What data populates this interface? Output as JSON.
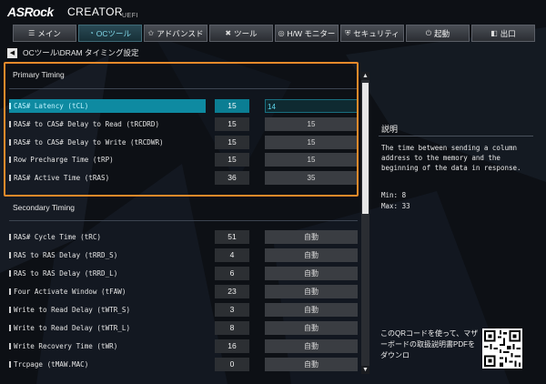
{
  "header": {
    "brand": "ASRock",
    "product": "CREATOR",
    "uefi": "UEFI"
  },
  "nav": [
    {
      "label": "メイン",
      "icon": "list-icon",
      "glyph": "☰"
    },
    {
      "label": "OCツール",
      "icon": "gauge-icon",
      "glyph": "◔",
      "active": true
    },
    {
      "label": "アドバンスド",
      "icon": "star-icon",
      "glyph": "✩"
    },
    {
      "label": "ツール",
      "icon": "tools-icon",
      "glyph": "✖"
    },
    {
      "label": "H/W モニター",
      "icon": "monitor-icon",
      "glyph": "◎"
    },
    {
      "label": "セキュリティ",
      "icon": "shield-icon",
      "glyph": "⛨"
    },
    {
      "label": "起動",
      "icon": "power-icon",
      "glyph": "⏻"
    },
    {
      "label": "出口",
      "icon": "exit-icon",
      "glyph": "◧"
    }
  ],
  "breadcrumb": "OCツール\\DRAM タイミング設定",
  "primary": {
    "title": "Primary Timing",
    "rows": [
      {
        "label": "CAS# Latency (tCL)",
        "value": "15",
        "input": "14",
        "selected": true
      },
      {
        "label": "RAS# to CAS# Delay to Read  (tRCDRD)",
        "value": "15",
        "input": "15"
      },
      {
        "label": "RAS# to CAS# Delay to Write (tRCDWR)",
        "value": "15",
        "input": "15"
      },
      {
        "label": "Row Precharge Time (tRP)",
        "value": "15",
        "input": "15"
      },
      {
        "label": "RAS# Active Time (tRAS)",
        "value": "36",
        "input": "35"
      }
    ]
  },
  "secondary": {
    "title": "Secondary Timing",
    "rows": [
      {
        "label": "RAS# Cycle Time (tRC)",
        "value": "51",
        "input": "自動"
      },
      {
        "label": "RAS to RAS Delay (tRRD_S)",
        "value": "4",
        "input": "自動"
      },
      {
        "label": "RAS to RAS Delay (tRRD_L)",
        "value": "6",
        "input": "自動"
      },
      {
        "label": "Four Activate Window (tFAW)",
        "value": "23",
        "input": "自動"
      },
      {
        "label": "Write to Read Delay (tWTR_S)",
        "value": "3",
        "input": "自動"
      },
      {
        "label": "Write to Read Delay (tWTR_L)",
        "value": "8",
        "input": "自動"
      },
      {
        "label": "Write Recovery Time (tWR)",
        "value": "16",
        "input": "自動"
      },
      {
        "label": "Trcpage (tMAW.MAC)",
        "value": "0",
        "input": "自動"
      }
    ]
  },
  "description": {
    "title": "説明",
    "text": "The time between sending a column address to the memory and the beginning of the data in response.",
    "min": "Min: 8",
    "max": "Max: 33"
  },
  "qr_note": "このQRコードを使って、マザーボードの取扱説明書PDFをダウンロ",
  "colors": {
    "accent": "#0e8aa1",
    "highlight": "#e98a2a",
    "background": "#0d1015"
  }
}
